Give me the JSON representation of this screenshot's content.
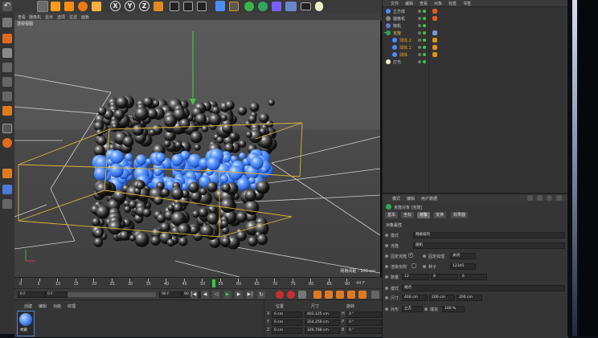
{
  "viewport": {
    "menu": [
      "查看",
      "摄像机",
      "显示",
      "选项",
      "过滤",
      "面板"
    ],
    "camera_label": "透视视图",
    "grid_label": "网格间距 : 100 cm"
  },
  "toolbar": {
    "axis_x": "X",
    "axis_y": "Y",
    "axis_z": "Z"
  },
  "timeline": {
    "ticks": [
      "0",
      "5",
      "10",
      "15",
      "20",
      "25",
      "30",
      "35",
      "40",
      "45",
      "50",
      "55",
      "60",
      "65",
      "70",
      "75",
      "80",
      "85",
      "90"
    ],
    "current_frame": 44,
    "end_label": "44 F"
  },
  "transport": {
    "start_field": "0 F",
    "start_field2": "0 F",
    "end_field": "90 F",
    "end_field2": "90 F"
  },
  "materials": {
    "menu": [
      "创建",
      "编辑",
      "功能",
      "纹理"
    ],
    "swatch_label": "材质"
  },
  "coordinates": {
    "headers": [
      "位置",
      "尺寸",
      "旋转"
    ],
    "rows": [
      {
        "axis": "X",
        "pos": "0 cm",
        "size": "403.125 cm",
        "rot_axis": "H",
        "rot": "0 °"
      },
      {
        "axis": "Y",
        "pos": "0 cm",
        "size": "354.259 cm",
        "rot_axis": "P",
        "rot": "0 °"
      },
      {
        "axis": "Z",
        "pos": "0 cm",
        "size": "326.788 cm",
        "rot_axis": "B",
        "rot": "0 °"
      }
    ]
  },
  "objects": {
    "menu": [
      "文件",
      "编辑",
      "查看",
      "对象",
      "标签",
      "书签"
    ],
    "items": [
      {
        "name": "立方体",
        "indent": 0,
        "expander": ""
      },
      {
        "name": "摄像机",
        "indent": 0,
        "expander": ""
      },
      {
        "name": "随机",
        "indent": 0,
        "expander": ""
      },
      {
        "name": "克隆",
        "indent": 0,
        "expander": "−"
      },
      {
        "name": "球体.2",
        "indent": 1,
        "expander": ""
      },
      {
        "name": "球体.1",
        "indent": 1,
        "expander": ""
      },
      {
        "name": "球体",
        "indent": 1,
        "expander": ""
      },
      {
        "name": "灯光",
        "indent": 0,
        "expander": ""
      }
    ]
  },
  "attributes": {
    "menu": [
      "模式",
      "编辑",
      "用户数据"
    ],
    "object_title": "克隆对象 [克隆]",
    "tabs": [
      "基本",
      "坐标",
      "对象",
      "变换",
      "效果器"
    ],
    "active_tab": 2,
    "section": "对象属性",
    "mode_label": "模式",
    "mode_value": "网格排列",
    "clone_label": "克隆",
    "clone_value": "随机",
    "fix_clone": "固定克隆",
    "fix_texture_label": "固定纹理",
    "fix_texture_value": "关闭",
    "instance_mode": "渲染实例",
    "seed_label": "种子",
    "seed_value": "12345",
    "count_label": "数量",
    "count_values": [
      "12",
      "8",
      "6"
    ],
    "mode2_label": "模式",
    "mode2_value": "端点",
    "size_label": "尺寸",
    "size_values": [
      "400 cm",
      "200 cm",
      "200 cm"
    ],
    "shape_label": "外形",
    "shape_value": "立方",
    "fill_label": "填充",
    "fill_value": "100 %"
  },
  "colors": {
    "accent_orange": "#ff9c1a",
    "selection_yellow": "#d8b43a",
    "sphere_blue": "#4d8dff",
    "y_axis_green": "#3ec83e"
  }
}
